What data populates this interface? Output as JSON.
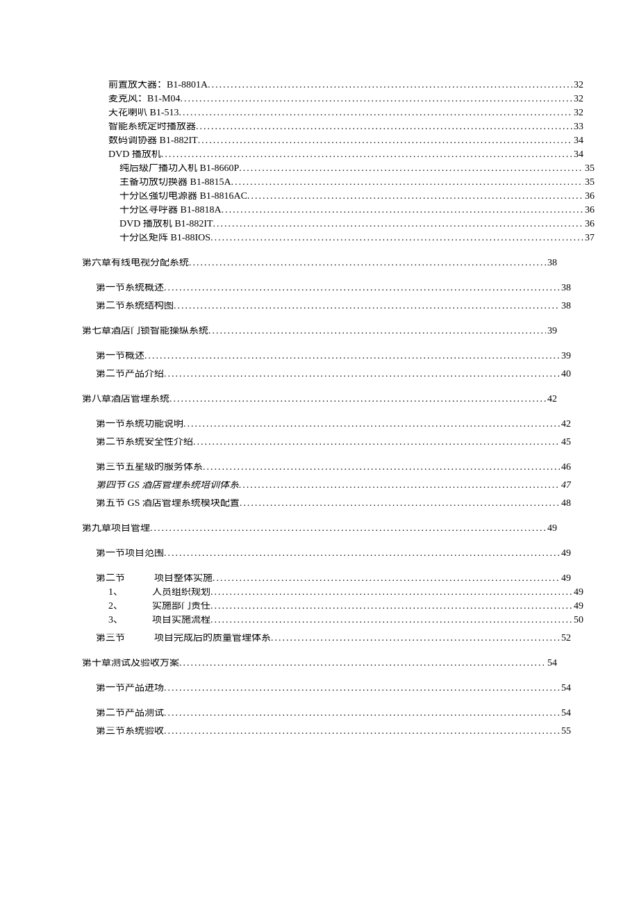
{
  "entries": [
    {
      "level": 2,
      "label": "前置放大器：B1-8801A ",
      "page": "32"
    },
    {
      "level": 2,
      "label": "麦克风：B1-M04",
      "page": "32"
    },
    {
      "level": 2,
      "label": "天花喇叭 B1-513 ",
      "page": "32"
    },
    {
      "level": 2,
      "label": "智能系统定时播放器",
      "page": "33"
    },
    {
      "level": 2,
      "label": "数码调协器 B1-882IT",
      "page": "34"
    },
    {
      "level": 2,
      "label": "DVD 播放机",
      "page": "34"
    },
    {
      "level": 3,
      "label": "纯后级广播功入机 B1-8660P",
      "page": "35"
    },
    {
      "level": 3,
      "label": "主备功放切换器 B1-8815A ",
      "page": "35"
    },
    {
      "level": 3,
      "label": "十分区强切电源器 B1-8816AC",
      "page": "36"
    },
    {
      "level": 3,
      "label": "十分区寻呼器 B1-8818A ",
      "page": "36"
    },
    {
      "level": 3,
      "label": "DVD 播放机 B1-882IT",
      "page": "36"
    },
    {
      "level": 3,
      "label": "十分区矩阵 B1-88IOS",
      "page": "37"
    },
    {
      "level": 0,
      "label": "第六章有线电视分配系统 ",
      "page": "38"
    },
    {
      "level": 1,
      "label": "第一节系统概述 ",
      "page": "38",
      "gap": true
    },
    {
      "level": 1,
      "label": "第二节系统结构图 ",
      "page": "38"
    },
    {
      "level": 0,
      "label": "第七章酒店门锁智能操纵系统 ",
      "page": "39"
    },
    {
      "level": 1,
      "label": "第一节概述 ",
      "page": "39",
      "gap": true
    },
    {
      "level": 1,
      "label": "第二节产品介绍 ",
      "page": "40"
    },
    {
      "level": 0,
      "label": "第八章酒店管理系统 ",
      "page": "42"
    },
    {
      "level": 1,
      "label": "第一节系统功能说明 ",
      "page": "42",
      "gap": true
    },
    {
      "level": 1,
      "label": "第二节系统安全性介绍 ",
      "page": "45"
    },
    {
      "level": 1,
      "label": "第三节五星级的服务体系 ",
      "page": "46",
      "gap": true
    },
    {
      "level": 1,
      "label": "第四节 GS 酒店管理系统培训体系 ",
      "page": "47",
      "italic": true
    },
    {
      "level": 1,
      "label": "第五节 GS 酒店管理系统模块配置",
      "page": "48"
    },
    {
      "level": 0,
      "label": "第九章项目管理 ",
      "page": "49"
    },
    {
      "level": 1,
      "label": "第一节项目范围 ",
      "page": "49",
      "gap": true
    },
    {
      "level": 1,
      "label_html": "第二节<span class='num-cell'></span>项目整体实施 ",
      "page": "49",
      "gap": true
    },
    {
      "level": 2,
      "label_html": "1、<span class='num-cell'></span>人员组织规划 ",
      "page": "49"
    },
    {
      "level": 2,
      "label_html": "2、<span class='num-cell'></span>实施部门责任 ",
      "page": "49"
    },
    {
      "level": 2,
      "label_html": "3、<span class='num-cell'></span>项目实施流程 ",
      "page": "50"
    },
    {
      "level": 1,
      "label_html": "第三节<span class='num-cell'></span>项目完成后的质量管理体系 ",
      "page": "52"
    },
    {
      "level": 0,
      "label": "第十章测试及验收方案 ",
      "page": "54"
    },
    {
      "level": 1,
      "label": "第一节产品进场 ",
      "page": "54",
      "gap": true
    },
    {
      "level": 1,
      "label": "第二节产品测试 ",
      "page": "54",
      "gap": true
    },
    {
      "level": 1,
      "label": "第三节系统验收 ",
      "page": "55"
    }
  ]
}
